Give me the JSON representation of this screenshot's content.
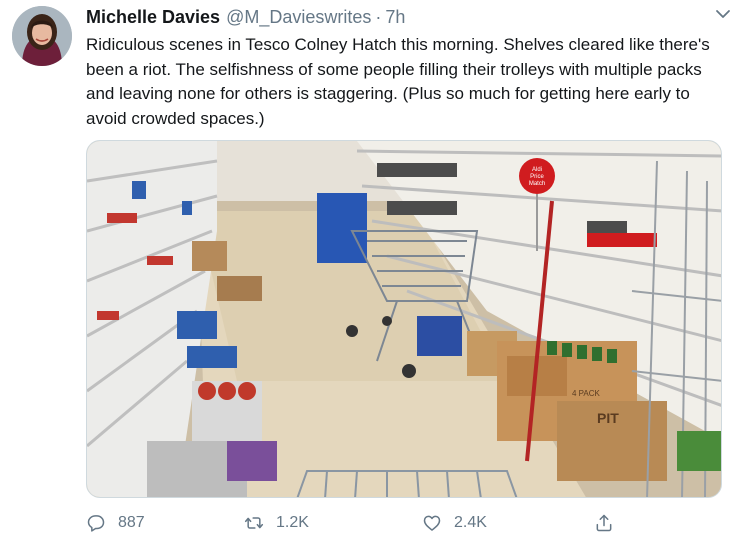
{
  "tweet": {
    "author_name": "Michelle Davies",
    "author_handle": "@M_Davieswrites",
    "separator": "·",
    "time": "7h",
    "text": "Ridiculous scenes in Tesco Colney Hatch this morning. Shelves cleared like there's been a riot. The selfishness of some people filling their trolleys with multiple packs and leaving none for others is staggering. (Plus so much for getting here early to avoid crowded spaces.)",
    "photo_signs": {
      "price_sign_line1": "Aldi",
      "price_sign_line2": "Price",
      "price_sign_line3": "Match",
      "box_text_1": "4 PACK",
      "box_text_2": "PIT"
    }
  },
  "actions": {
    "replies": "887",
    "retweets": "1.2K",
    "likes": "2.4K"
  },
  "icons": {
    "reply": "reply-icon",
    "retweet": "retweet-icon",
    "like": "heart-icon",
    "share": "share-icon",
    "menu": "chevron-down-icon"
  },
  "colors": {
    "secondary_text": "#657786",
    "primary_text": "#14171a",
    "tesco_red": "#d01c1f"
  }
}
